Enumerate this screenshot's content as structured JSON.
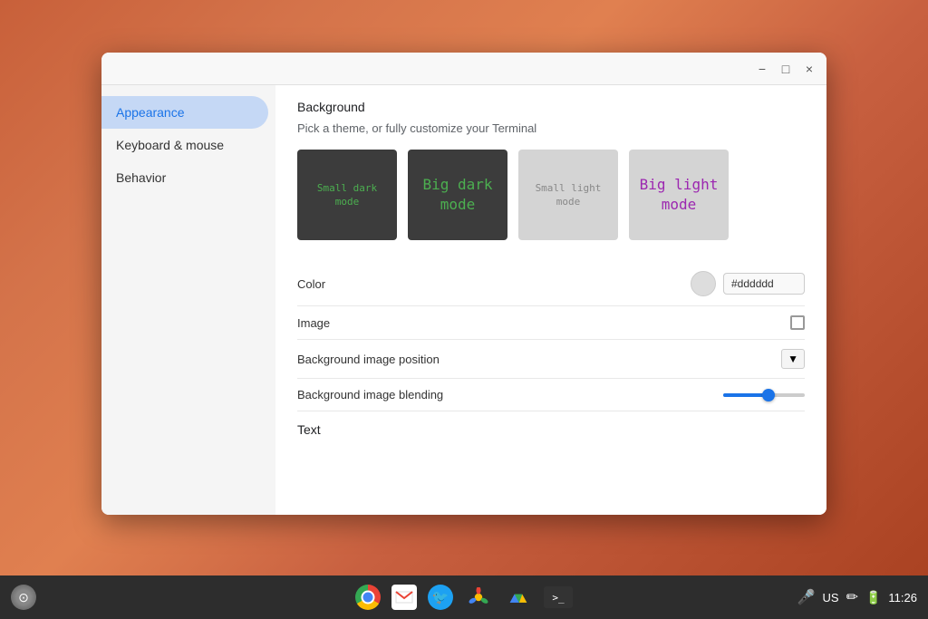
{
  "desktop": {
    "bg_color": "#c8603a"
  },
  "window": {
    "titlebar": {
      "minimize_label": "−",
      "maximize_label": "□",
      "close_label": "×"
    },
    "sidebar": {
      "items": [
        {
          "id": "appearance",
          "label": "Appearance",
          "active": true
        },
        {
          "id": "keyboard-mouse",
          "label": "Keyboard & mouse",
          "active": false
        },
        {
          "id": "behavior",
          "label": "Behavior",
          "active": false
        }
      ]
    },
    "content": {
      "background_section_title": "Background",
      "background_subtitle": "Pick a theme, or fully customize your Terminal",
      "themes": [
        {
          "id": "small-dark",
          "label": "Small dark\nmode",
          "style": "dark-small"
        },
        {
          "id": "big-dark",
          "label": "Big dark\nmode",
          "style": "dark-big"
        },
        {
          "id": "small-light",
          "label": "Small light\nmode",
          "style": "light-small"
        },
        {
          "id": "big-light",
          "label": "Big light\nmode",
          "style": "light-big"
        }
      ],
      "color_label": "Color",
      "color_value": "#dddddd",
      "image_label": "Image",
      "bg_image_position_label": "Background image position",
      "bg_image_blending_label": "Background image blending",
      "text_section_title": "Text",
      "slider_percent": 55
    }
  },
  "taskbar": {
    "launcher_icon": "⊙",
    "apps": [
      {
        "id": "chrome",
        "label": "Chrome"
      },
      {
        "id": "gmail",
        "label": "Gmail"
      },
      {
        "id": "twitter",
        "label": "Twitter"
      },
      {
        "id": "photos",
        "label": "Photos"
      },
      {
        "id": "drive",
        "label": "Drive"
      },
      {
        "id": "terminal",
        "label": ">_"
      }
    ],
    "status": {
      "mic_icon": "🎤",
      "locale": "US",
      "pencil_icon": "✏",
      "battery_icon": "🔋",
      "time": "11:26"
    }
  }
}
